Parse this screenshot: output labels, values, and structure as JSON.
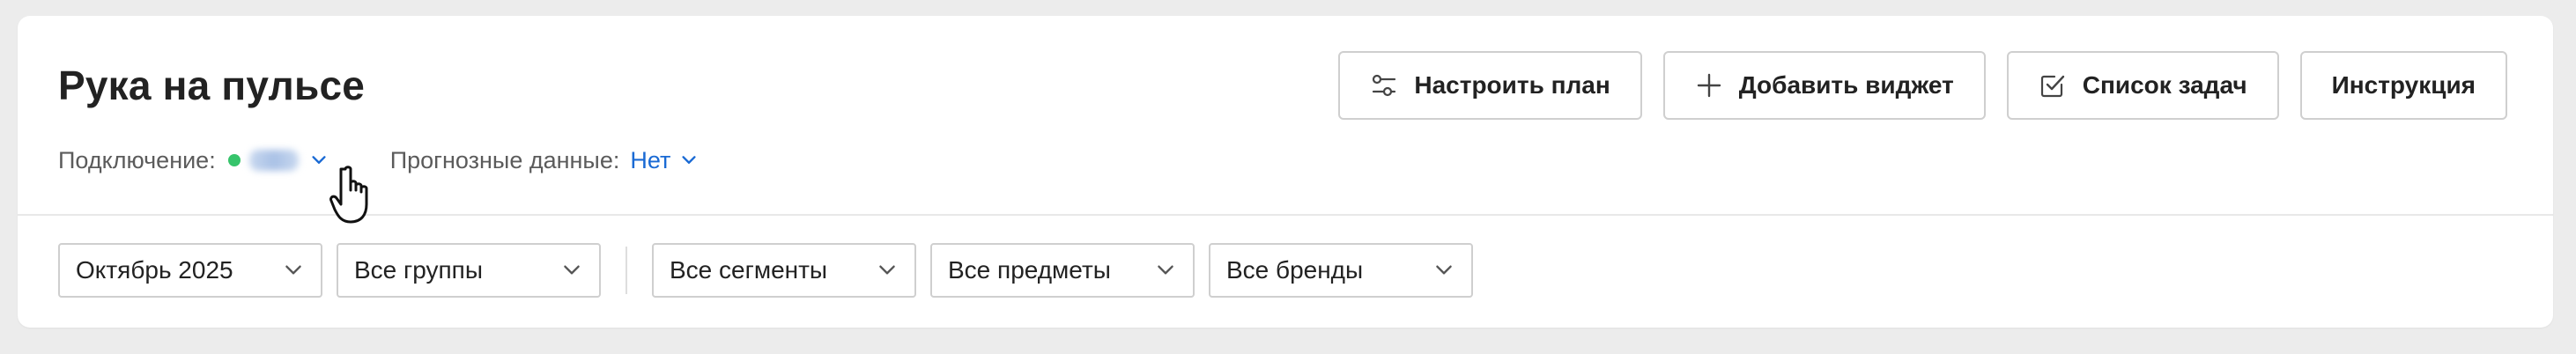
{
  "header": {
    "title": "Рука на пульсе",
    "connection": {
      "label": "Подключение:",
      "status_color": "#36c46b"
    },
    "forecast": {
      "label": "Прогнозные данные:",
      "value": "Нет"
    }
  },
  "actions": [
    {
      "label": "Настроить план",
      "icon": "sliders-icon"
    },
    {
      "label": "Добавить виджет",
      "icon": "plus-icon"
    },
    {
      "label": "Список задач",
      "icon": "checkbox-icon"
    },
    {
      "label": "Инструкция",
      "icon": null
    }
  ],
  "filters": {
    "period": "Октябрь 2025",
    "groups": "Все группы",
    "segments": "Все сегменты",
    "subjects": "Все предметы",
    "brands": "Все бренды"
  },
  "colors": {
    "accent": "#1a6ad4",
    "border": "#cfcfcf",
    "background": "#ececec"
  }
}
